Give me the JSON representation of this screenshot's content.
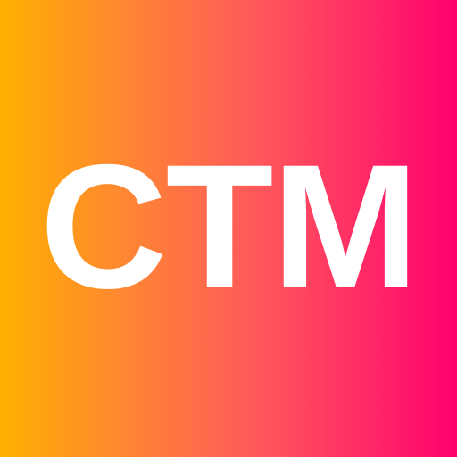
{
  "icon": {
    "logo_text": "CTM",
    "colors": {
      "text": "#FFFFFF",
      "gradient_start": "#FFB000",
      "gradient_mid": "#FF5A5A",
      "gradient_end": "#FF006E"
    }
  }
}
